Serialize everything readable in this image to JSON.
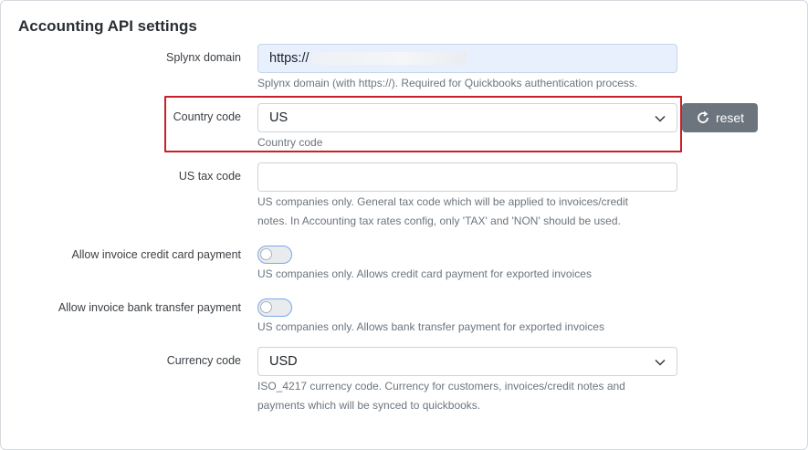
{
  "section_title": "Accounting API settings",
  "splynx_domain": {
    "label": "Splynx domain",
    "value": "https://",
    "help": "Splynx domain (with https://). Required for Quickbooks authentication process."
  },
  "country_code": {
    "label": "Country code",
    "value": "US",
    "help": "Country code",
    "reset_label": "reset"
  },
  "us_tax_code": {
    "label": "US tax code",
    "value": "",
    "help_line1": "US companies only. General tax code which will be applied to invoices/credit",
    "help_line2": "notes. In Accounting tax rates config, only 'TAX' and 'NON' should be used."
  },
  "credit_card": {
    "label": "Allow invoice credit card payment",
    "enabled": false,
    "help": "US companies only. Allows credit card payment for exported invoices"
  },
  "bank_transfer": {
    "label": "Allow invoice bank transfer payment",
    "enabled": false,
    "help": "US companies only. Allows bank transfer payment for exported invoices"
  },
  "currency_code": {
    "label": "Currency code",
    "value": "USD",
    "help_line1": "ISO_4217 currency code. Currency for customers, invoices/credit notes and",
    "help_line2": "payments which will be synced to quickbooks."
  },
  "colors": {
    "highlight": "#c8202a",
    "reset_button": "#6c757d",
    "toggle_border": "#7aa7e8"
  }
}
